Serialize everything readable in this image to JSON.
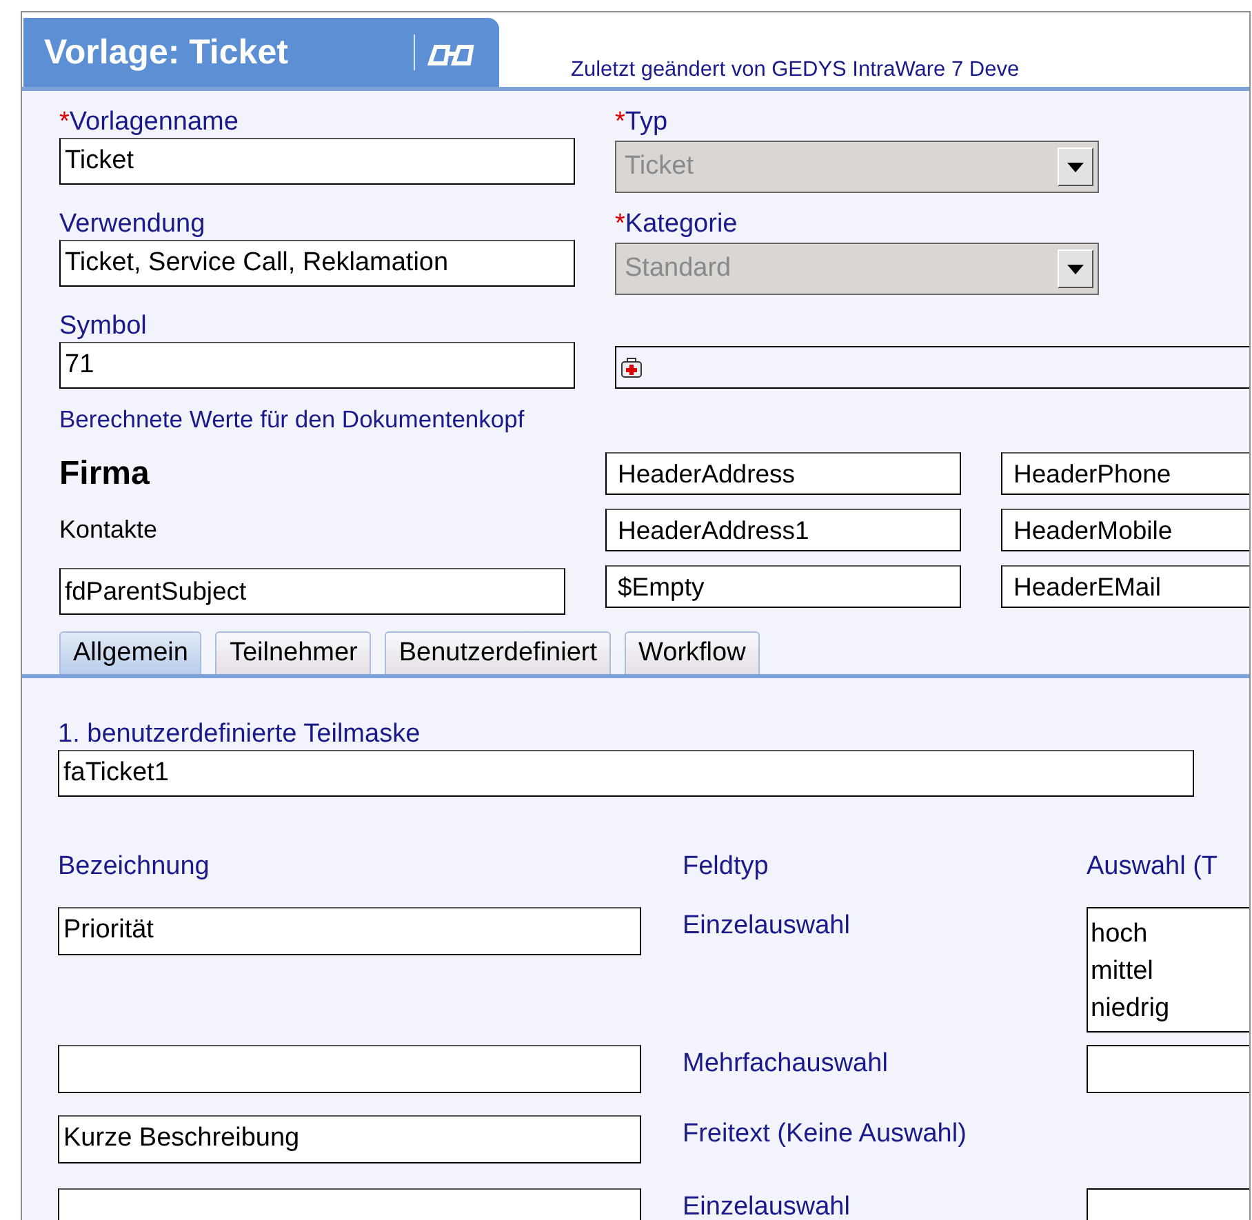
{
  "header": {
    "title": "Vorlage: Ticket",
    "modified": "Zuletzt geändert von GEDYS IntraWare 7 Deve"
  },
  "form": [
    {
      "label": "Vorlagenname",
      "required_mark": "*",
      "kind": "text",
      "value": "Ticket"
    },
    {
      "label": "Typ",
      "required_mark": "*",
      "kind": "dropdown",
      "value": "Ticket",
      "disabled": true
    },
    {
      "label": "Verwendung",
      "kind": "text",
      "value": "Ticket, Service Call, Reklamation"
    },
    {
      "label": "Kategorie",
      "required_mark": "*",
      "kind": "dropdown",
      "value": "Standard",
      "disabled": true
    },
    {
      "label": "Symbol",
      "kind": "text",
      "value": "71"
    },
    {
      "kind": "icon-field"
    }
  ],
  "computed": {
    "title": "Berechnete Werte für den Dokumentenkopf",
    "rows": [
      {
        "kind": "strong",
        "label": "Firma",
        "values": [
          "HeaderAddress",
          "HeaderPhone"
        ]
      },
      {
        "kind": "plain",
        "label": "Kontakte",
        "values": [
          "HeaderAddress1",
          "HeaderMobile"
        ]
      },
      {
        "kind": "field",
        "label": "fdParentSubject",
        "values": [
          "$Empty",
          "HeaderEMail"
        ]
      }
    ]
  },
  "tabs": [
    {
      "label": "Allgemein",
      "selected": true
    },
    {
      "label": "Teilnehmer",
      "selected": false
    },
    {
      "label": "Benutzerdefiniert",
      "selected": false
    },
    {
      "label": "Workflow",
      "selected": false
    }
  ],
  "subform": {
    "label": "1. benutzerdefinierte Teilmaske",
    "value": "faTicket1"
  },
  "columns": [
    "Bezeichnung",
    "Feldtyp",
    "Auswahl (T"
  ],
  "rows": [
    {
      "name": "Priorität",
      "type": "Einzelauswahl",
      "kind": "list",
      "choices": [
        "hoch",
        "mittel",
        "niedrig"
      ]
    },
    {
      "type": "Mehrfachauswahl",
      "kind": "list"
    },
    {
      "name": "Kurze Beschreibung",
      "type": "Freitext (Keine Auswahl)",
      "kind": "none"
    },
    {
      "type": "Einzelauswahl",
      "kind": "list"
    }
  ]
}
